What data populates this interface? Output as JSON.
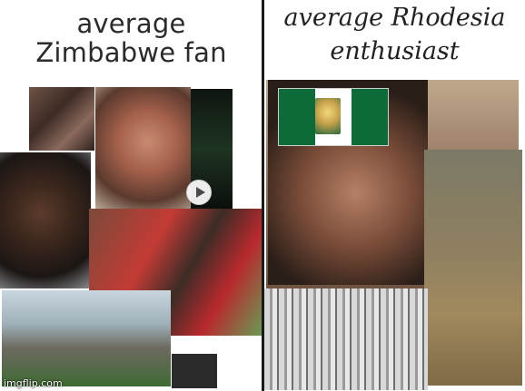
{
  "left_panel": {
    "title_lines": [
      "average",
      "Zimbabwe fan"
    ]
  },
  "right_panel": {
    "title_lines": [
      "average Rhodesia",
      "enthusiast"
    ]
  },
  "watermark": "imgflip.com",
  "colors": {
    "divider": "#1a1a1a",
    "title": "#2b2b2b",
    "flag_green": "#0d6b3a",
    "flag_white": "#ffffff"
  },
  "icons": {
    "play": "play-icon"
  }
}
